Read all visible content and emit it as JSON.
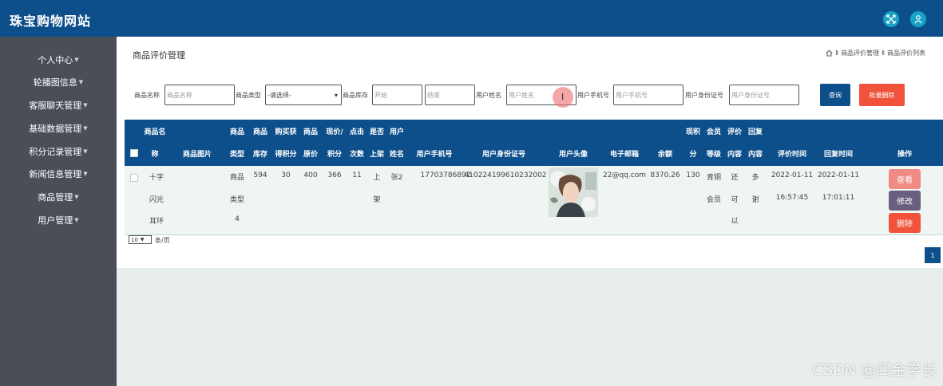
{
  "app": {
    "title": "珠宝购物网站"
  },
  "sidebar": {
    "items": [
      {
        "label": "个人中心"
      },
      {
        "label": "轮播图信息"
      },
      {
        "label": "客服聊天管理"
      },
      {
        "label": "基础数据管理"
      },
      {
        "label": "积分记录管理"
      },
      {
        "label": "新闻信息管理"
      },
      {
        "label": "商品管理"
      },
      {
        "label": "用户管理"
      }
    ]
  },
  "page": {
    "title": "商品评价管理",
    "breadcrumb": [
      "商品评价管理",
      "商品评价列表"
    ]
  },
  "search": {
    "name_label": "商品名称",
    "name_placeholder": "商品名称",
    "type_label": "商品类型",
    "type_value": "-请选择-",
    "stock_label": "商品库存",
    "stock_start_placeholder": "开始",
    "stock_end_placeholder": "结束",
    "user_name_label": "用户姓名",
    "user_name_placeholder": "用户姓名",
    "user_phone_label": "用户手机号",
    "user_phone_placeholder": "用户手机号",
    "user_id_label": "用户身份证号",
    "user_id_placeholder": "用户身份证号",
    "query_button": "查询",
    "batch_delete_button": "批量删除"
  },
  "table": {
    "headers": {
      "name_1": "商品名",
      "name_2": "称",
      "image": "商品图片",
      "type_1": "商品",
      "type_2": "类型",
      "stock_1": "商品",
      "stock_2": "库存",
      "points_1": "购买获",
      "points_2": "得积分",
      "orig_1": "商品",
      "orig_2": "原价",
      "cur_1": "现价/",
      "cur_2": "积分",
      "clicks_1": "点击",
      "clicks_2": "次数",
      "shelf_1": "是否",
      "shelf_2": "上架",
      "uname_1": "用户",
      "uname_2": "姓名",
      "phone": "用户手机号",
      "idno": "用户身份证号",
      "avatar": "用户头像",
      "email": "电子邮箱",
      "balance": "余额",
      "cpoints_1": "现积",
      "cpoints_2": "分",
      "level_1": "会员",
      "level_2": "等级",
      "review_1": "评价",
      "review_2": "内容",
      "reply_1": "回复",
      "reply_2": "内容",
      "review_time": "评价时间",
      "reply_time": "回复时间",
      "actions": "操作"
    },
    "rows": [
      {
        "name": [
          "十字",
          "闪光",
          "耳环"
        ],
        "type": [
          "商品",
          "类型",
          "4"
        ],
        "stock": "594",
        "points": "30",
        "orig": "400",
        "cur": "366",
        "clicks": "11",
        "shelf": [
          "上",
          "架"
        ],
        "uname": "张2",
        "phone": "17703786892",
        "idno": "410224199610232002",
        "email": "22@qq.com",
        "balance": "8370.26",
        "cpoints": "130",
        "level": [
          "青铜",
          "会员"
        ],
        "review": [
          "还",
          "可",
          "以"
        ],
        "reply": [
          "多",
          "谢"
        ],
        "review_time": [
          "2022-01-11",
          "16:57:45"
        ],
        "reply_time": [
          "2022-01-11",
          "17:01:11"
        ],
        "actions": {
          "view": "查看",
          "edit": "修改",
          "delete": "删除"
        }
      }
    ]
  },
  "pagination": {
    "page_size": "10",
    "page_size_suffix": "条/页",
    "current_page": "1"
  },
  "watermark": "CSDN @四金学长",
  "colors": {
    "header": "#0d4f8b",
    "sidebar": "#4a4f57",
    "danger": "#f0533a",
    "view": "#f08a84",
    "edit": "#6a5e7e",
    "icon_accent": "#17a2c8"
  }
}
